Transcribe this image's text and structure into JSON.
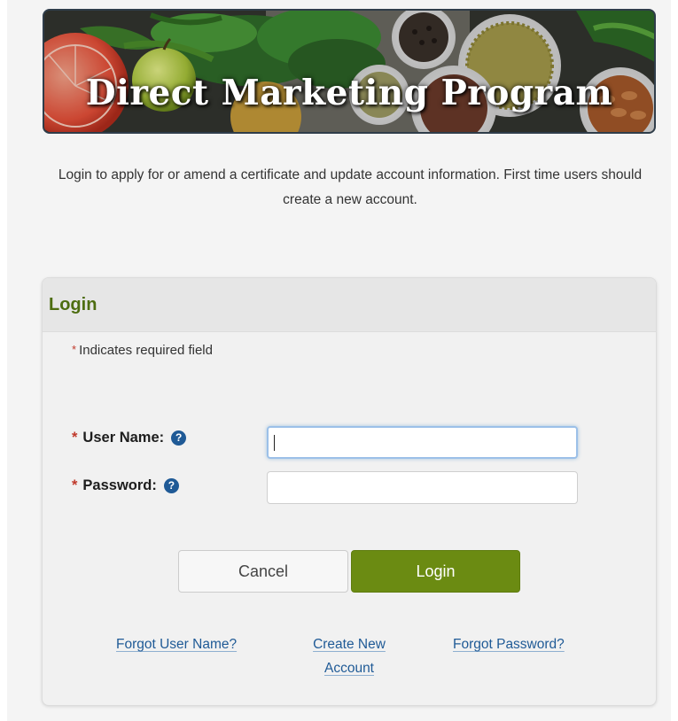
{
  "banner": {
    "title": "Direct Marketing Program"
  },
  "intro": {
    "text": "Login to apply for or amend a certificate and update account information. First time users should create a new account."
  },
  "login": {
    "title": "Login",
    "required_star": "*",
    "required_note": "Indicates required field",
    "username": {
      "star": "*",
      "label": "User Name:",
      "help_glyph": "?",
      "value": ""
    },
    "password": {
      "star": "*",
      "label": "Password:",
      "help_glyph": "?",
      "value": ""
    },
    "cancel_label": "Cancel",
    "login_label": "Login",
    "links": {
      "forgot_username": "Forgot User Name?",
      "create_account_line1": "Create New",
      "create_account_line2": "Account",
      "forgot_password": "Forgot Password?"
    }
  },
  "colors": {
    "accent_green": "#6b8b12",
    "title_green": "#4d6d10",
    "link_blue": "#1f5a96",
    "required_red": "#c0392b"
  },
  "icons": {
    "help": "question-circle-icon",
    "banner": "vegetables-image"
  }
}
